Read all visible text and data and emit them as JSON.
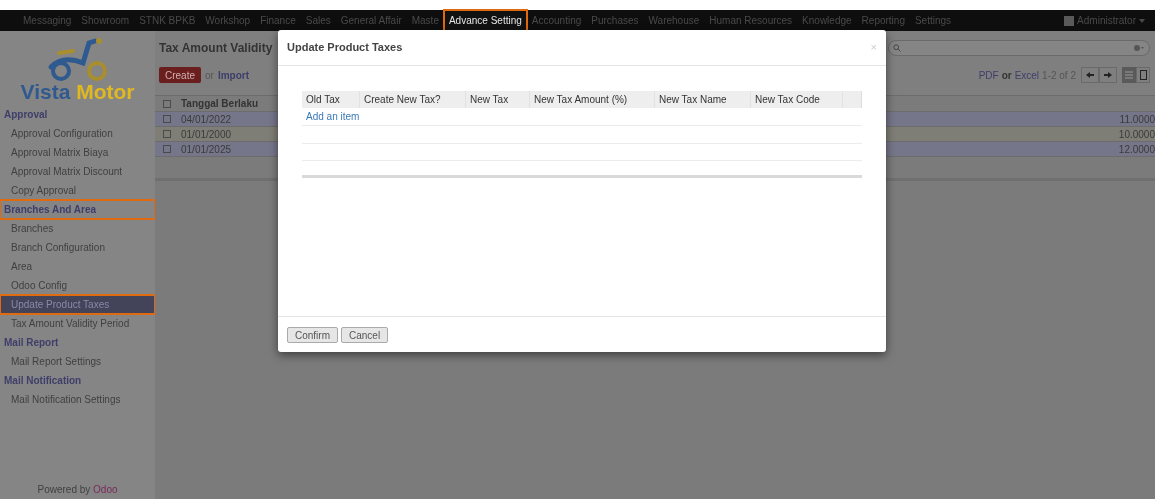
{
  "menu": [
    {
      "label": "Messaging",
      "selected": false,
      "highlighted": false
    },
    {
      "label": "Showroom",
      "selected": false,
      "highlighted": false
    },
    {
      "label": "STNK BPKB",
      "selected": false,
      "highlighted": false
    },
    {
      "label": "Workshop",
      "selected": false,
      "highlighted": false
    },
    {
      "label": "Finance",
      "selected": false,
      "highlighted": false
    },
    {
      "label": "Sales",
      "selected": false,
      "highlighted": false
    },
    {
      "label": "General Affair",
      "selected": false,
      "highlighted": false
    },
    {
      "label": "Maste",
      "selected": false,
      "highlighted": false
    },
    {
      "label": "Advance Setting",
      "selected": true,
      "highlighted": true
    },
    {
      "label": "Accounting",
      "selected": false,
      "highlighted": false
    },
    {
      "label": "Purchases",
      "selected": false,
      "highlighted": false
    },
    {
      "label": "Warehouse",
      "selected": false,
      "highlighted": false
    },
    {
      "label": "Human Resources",
      "selected": false,
      "highlighted": false
    },
    {
      "label": "Knowledge",
      "selected": false,
      "highlighted": false
    },
    {
      "label": "Reporting",
      "selected": false,
      "highlighted": false
    },
    {
      "label": "Settings",
      "selected": false,
      "highlighted": false
    }
  ],
  "user": "Administrator",
  "logo": {
    "word1": "Vista",
    "word2": "Motor"
  },
  "sidebar": [
    {
      "label": "Approval",
      "highlighted": false,
      "children": [
        {
          "label": "Approval Configuration",
          "selected": false,
          "highlighted": false
        },
        {
          "label": "Approval Matrix Biaya",
          "selected": false,
          "highlighted": false
        },
        {
          "label": "Approval Matrix Discount",
          "selected": false,
          "highlighted": false
        },
        {
          "label": "Copy Approval",
          "selected": false,
          "highlighted": false
        }
      ]
    },
    {
      "label": "Branches And Area",
      "highlighted": true,
      "children": [
        {
          "label": "Branches",
          "selected": false,
          "highlighted": false
        },
        {
          "label": "Branch Configuration",
          "selected": false,
          "highlighted": false
        },
        {
          "label": "Area",
          "selected": false,
          "highlighted": false
        },
        {
          "label": "Odoo Config",
          "selected": false,
          "highlighted": false
        },
        {
          "label": "Update Product Taxes",
          "selected": true,
          "highlighted": true
        },
        {
          "label": "Tax Amount Validity Period",
          "selected": false,
          "highlighted": false
        }
      ]
    },
    {
      "label": "Mail Report",
      "highlighted": false,
      "children": [
        {
          "label": "Mail Report Settings",
          "selected": false,
          "highlighted": false
        }
      ]
    },
    {
      "label": "Mail Notification",
      "highlighted": false,
      "children": [
        {
          "label": "Mail Notification Settings",
          "selected": false,
          "highlighted": false
        }
      ]
    }
  ],
  "powered_by": {
    "text": "Powered by",
    "link": "Odoo"
  },
  "view": {
    "title": "Tax Amount Validity",
    "create": "Create",
    "or": "or",
    "import": "Import",
    "pager": {
      "pdf": "PDF",
      "or": "or",
      "excel": "Excel",
      "range": "1-2 of 2"
    },
    "column": "Tanggal Berlaku",
    "all_checked": false,
    "rows": [
      {
        "date": "04/01/2022",
        "amount": "11.0000",
        "checked": false
      },
      {
        "date": "01/01/2000",
        "amount": "10.0000",
        "checked": false
      },
      {
        "date": "01/01/2025",
        "amount": "12.0000",
        "checked": false
      }
    ]
  },
  "dialog": {
    "title": "Update Product Taxes",
    "close": "×",
    "columns": [
      "Old Tax",
      "Create New Tax?",
      "New Tax",
      "New Tax Amount (%)",
      "New Tax Name",
      "New Tax Code"
    ],
    "add_item": "Add an item",
    "buttons": [
      "Confirm",
      "Cancel"
    ]
  }
}
